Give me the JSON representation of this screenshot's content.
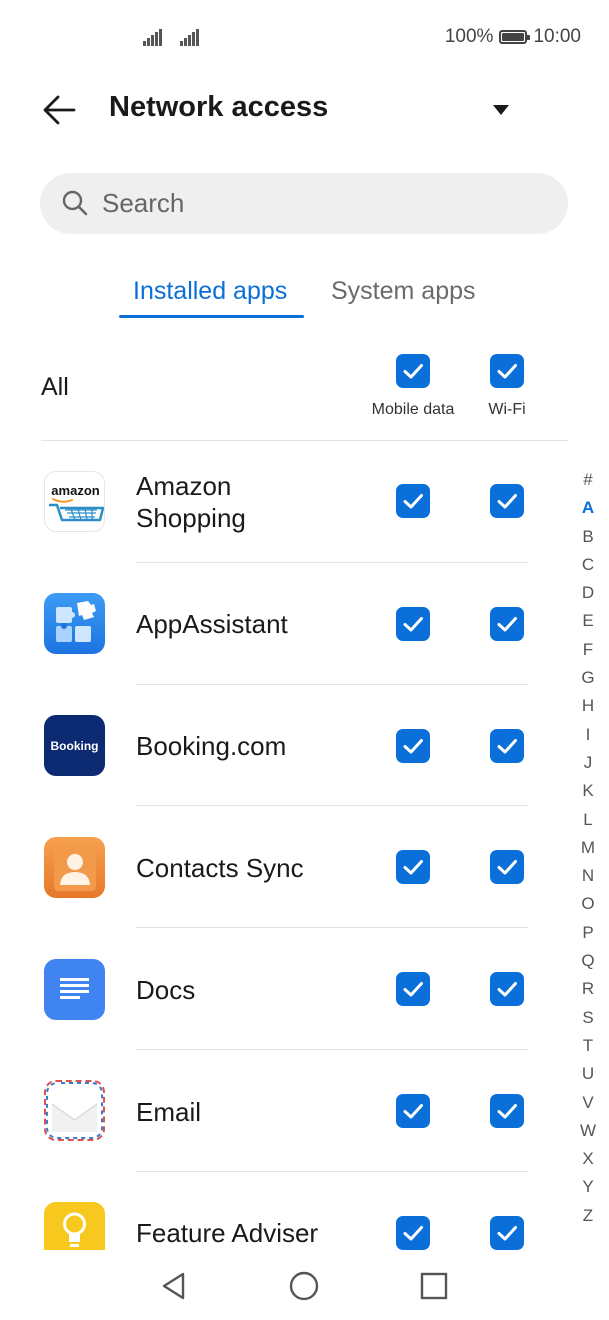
{
  "status_bar": {
    "battery": "100%",
    "time": "10:00"
  },
  "header": {
    "title": "Network access"
  },
  "search": {
    "placeholder": "Search"
  },
  "tabs": [
    {
      "label": "Installed apps",
      "active": true
    },
    {
      "label": "System apps",
      "active": false
    }
  ],
  "all_row": {
    "label": "All",
    "mobile_data_label": "Mobile data",
    "wifi_label": "Wi-Fi",
    "mobile_data_checked": true,
    "wifi_checked": true
  },
  "apps": [
    {
      "name_line1": "Amazon",
      "name_line2": "Shopping",
      "icon": "amazon-icon",
      "mobile_data": true,
      "wifi": true
    },
    {
      "name_line1": "AppAssistant",
      "name_line2": "",
      "icon": "puzzle-icon",
      "mobile_data": true,
      "wifi": true
    },
    {
      "name_line1": "Booking.com",
      "name_line2": "",
      "icon": "booking-icon",
      "icon_text": "Booking",
      "mobile_data": true,
      "wifi": true
    },
    {
      "name_line1": "Contacts Sync",
      "name_line2": "",
      "icon": "contact-person-icon",
      "mobile_data": true,
      "wifi": true
    },
    {
      "name_line1": "Docs",
      "name_line2": "",
      "icon": "document-icon",
      "mobile_data": true,
      "wifi": true
    },
    {
      "name_line1": "Email",
      "name_line2": "",
      "icon": "envelope-icon",
      "mobile_data": true,
      "wifi": true
    },
    {
      "name_line1": "Feature Adviser",
      "name_line2": "",
      "icon": "lightbulb-icon",
      "mobile_data": true,
      "wifi": true
    }
  ],
  "index_letters": [
    "#",
    "A",
    "B",
    "C",
    "D",
    "E",
    "F",
    "G",
    "H",
    "I",
    "J",
    "K",
    "L",
    "M",
    "N",
    "O",
    "P",
    "Q",
    "R",
    "S",
    "T",
    "U",
    "V",
    "W",
    "X",
    "Y",
    "Z"
  ],
  "index_active": "A",
  "colors": {
    "accent": "#0a6fd9",
    "checkbox": "#0a6fd9",
    "divider": "#e3e3e3",
    "search_bg": "#efefef"
  }
}
